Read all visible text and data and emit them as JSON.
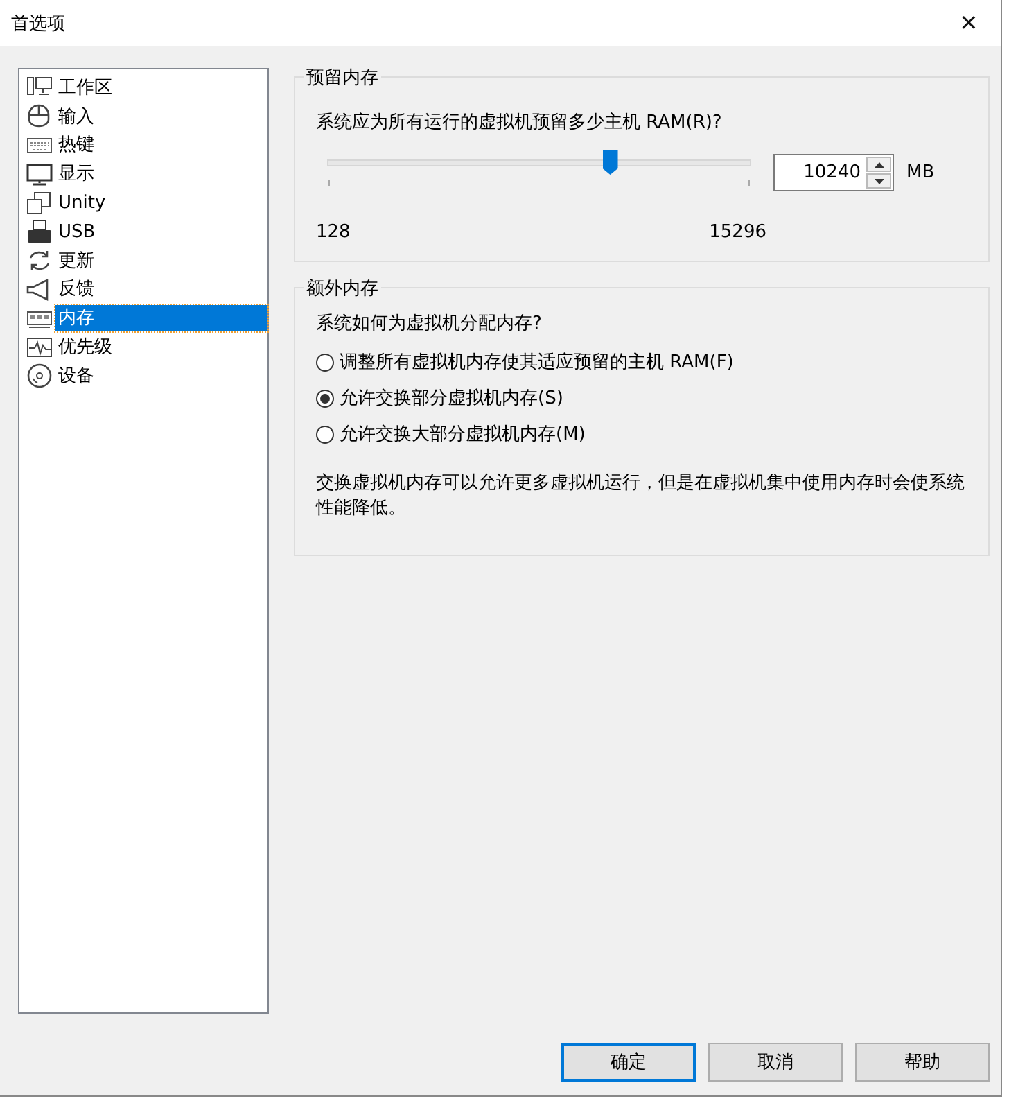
{
  "window": {
    "title": "首选项",
    "close": "✕"
  },
  "sidebar": {
    "items": [
      {
        "label": "工作区",
        "selected": false
      },
      {
        "label": "输入",
        "selected": false
      },
      {
        "label": "热键",
        "selected": false
      },
      {
        "label": "显示",
        "selected": false
      },
      {
        "label": "Unity",
        "selected": false
      },
      {
        "label": "USB",
        "selected": false
      },
      {
        "label": "更新",
        "selected": false
      },
      {
        "label": "反馈",
        "selected": false
      },
      {
        "label": "内存",
        "selected": true
      },
      {
        "label": "优先级",
        "selected": false
      },
      {
        "label": "设备",
        "selected": false
      }
    ]
  },
  "reserved_memory": {
    "title": "预留内存",
    "question": "系统应为所有运行的虚拟机预留多少主机 RAM(R)?",
    "slider": {
      "level": 0.667,
      "min_label": "128",
      "max_label": "15296"
    },
    "spinner": {
      "value": "10240",
      "unit": "MB"
    }
  },
  "additional_memory": {
    "title": "额外内存",
    "question": "系统如何为虚拟机分配内存?",
    "options": [
      {
        "label": "调整所有虚拟机内存使其适应预留的主机 RAM(F)",
        "selected": false
      },
      {
        "label": "允许交换部分虚拟机内存(S)",
        "selected": true
      },
      {
        "label": "允许交换大部分虚拟机内存(M)",
        "selected": false
      }
    ],
    "note": "交换虚拟机内存可以允许更多虚拟机运行，但是在虚拟机集中使用内存时会使系统性能降低。"
  },
  "buttons": [
    {
      "label": "确定",
      "default": true
    },
    {
      "label": "取消",
      "default": false
    },
    {
      "label": "帮助",
      "default": false
    }
  ]
}
